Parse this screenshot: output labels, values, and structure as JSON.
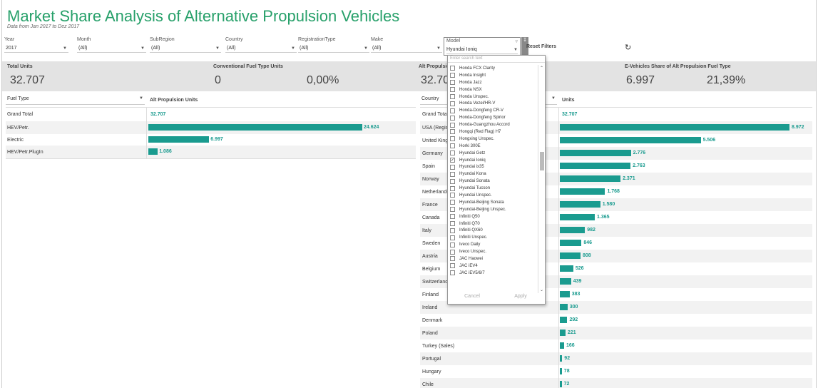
{
  "header": {
    "title": "Market Share Analysis of Alternative Propulsion Vehicles",
    "subtitle": "Data from Jan 2017 to Dez 2017"
  },
  "filters": [
    {
      "label": "Year",
      "value": "2017"
    },
    {
      "label": "Month",
      "value": "(All)"
    },
    {
      "label": "SubRegion",
      "value": "(All)"
    },
    {
      "label": "Country",
      "value": "(All)"
    },
    {
      "label": "RegistrationType",
      "value": "(All)"
    },
    {
      "label": "Make",
      "value": "(All)"
    }
  ],
  "model_filter": {
    "label": "Model",
    "value": "Hyundai Ioniq"
  },
  "reset_label": "Reset Filters",
  "kpis": {
    "total_units_label": "Total Units",
    "total_units_value": "32.707",
    "conv_label": "Conventional Fuel Type Units",
    "conv_value": "0",
    "conv_pct": "0,00%",
    "alt_label": "Alt Propulsio",
    "alt_value": "32.70",
    "ev_label": "E-Vehicles Share of Alt Propulsion Fuel Type",
    "ev_value": "6.997",
    "ev_pct": "21,39%"
  },
  "left_table": {
    "selector": "Fuel Type",
    "column_header": "Alt Propulsion Units",
    "grand_total_label": "Grand Total",
    "grand_total_value": "32.707",
    "rows": [
      {
        "label": "HEV/Petr.",
        "value": 24624,
        "display": "24.624"
      },
      {
        "label": "Electric",
        "value": 6997,
        "display": "6.997"
      },
      {
        "label": "HEV/Petr.PlugIn",
        "value": 1086,
        "display": "1.086"
      }
    ]
  },
  "right_table": {
    "selector": "Country",
    "column_header": "Units",
    "grand_total_label": "Grand Total",
    "grand_total_value": "32.707",
    "rows": [
      {
        "label": "USA (Regist",
        "value": 8972,
        "display": "8.972"
      },
      {
        "label": "United Kingd",
        "value": 5506,
        "display": "5.506"
      },
      {
        "label": "Germany",
        "value": 2776,
        "display": "2.776"
      },
      {
        "label": "Spain",
        "value": 2763,
        "display": "2.763"
      },
      {
        "label": "Norway",
        "value": 2371,
        "display": "2.371"
      },
      {
        "label": "Netherlands",
        "value": 1768,
        "display": "1.768"
      },
      {
        "label": "France",
        "value": 1580,
        "display": "1.580"
      },
      {
        "label": "Canada",
        "value": 1365,
        "display": "1.365"
      },
      {
        "label": "Italy",
        "value": 982,
        "display": "982"
      },
      {
        "label": "Sweden",
        "value": 846,
        "display": "846"
      },
      {
        "label": "Austria",
        "value": 808,
        "display": "808"
      },
      {
        "label": "Belgium",
        "value": 526,
        "display": "526"
      },
      {
        "label": "Switzerland",
        "value": 439,
        "display": "439"
      },
      {
        "label": "Finland",
        "value": 383,
        "display": "383"
      },
      {
        "label": "Ireland",
        "value": 300,
        "display": "300"
      },
      {
        "label": "Denmark",
        "value": 292,
        "display": "292"
      },
      {
        "label": "Poland",
        "value": 221,
        "display": "221"
      },
      {
        "label": "Turkey (Sales)",
        "value": 166,
        "display": "166"
      },
      {
        "label": "Portugal",
        "value": 92,
        "display": "92"
      },
      {
        "label": "Hungary",
        "value": 78,
        "display": "78"
      },
      {
        "label": "Chile",
        "value": 72,
        "display": "72"
      }
    ]
  },
  "dropdown": {
    "search_placeholder": "Enter search text",
    "items": [
      {
        "label": "Honda FCX Clarity",
        "checked": false
      },
      {
        "label": "Honda Insight",
        "checked": false
      },
      {
        "label": "Honda Jazz",
        "checked": false
      },
      {
        "label": "Honda NSX",
        "checked": false
      },
      {
        "label": "Honda Unspec.",
        "checked": false
      },
      {
        "label": "Honda Vezel/HR-V",
        "checked": false
      },
      {
        "label": "Honda-Dongfeng CR-V",
        "checked": false
      },
      {
        "label": "Honda-Dongfeng Spirior",
        "checked": false
      },
      {
        "label": "Honda-Guangzhou Accord",
        "checked": false
      },
      {
        "label": "Hongqi (Red Flag) H7",
        "checked": false
      },
      {
        "label": "Hongxing Unspec.",
        "checked": false
      },
      {
        "label": "Horki 300E",
        "checked": false
      },
      {
        "label": "Hyundai Getz",
        "checked": false
      },
      {
        "label": "Hyundai Ioniq",
        "checked": true
      },
      {
        "label": "Hyundai ix35",
        "checked": false
      },
      {
        "label": "Hyundai Kona",
        "checked": false
      },
      {
        "label": "Hyundai Sonata",
        "checked": false
      },
      {
        "label": "Hyundai Tucson",
        "checked": false
      },
      {
        "label": "Hyundai Unspec.",
        "checked": false
      },
      {
        "label": "Hyundai-Beijing Sonata",
        "checked": false
      },
      {
        "label": "Hyundai-Beijing Unspec.",
        "checked": false
      },
      {
        "label": "Infiniti Q50",
        "checked": false
      },
      {
        "label": "Infiniti Q70",
        "checked": false
      },
      {
        "label": "Infiniti QX60",
        "checked": false
      },
      {
        "label": "Infiniti Unspec.",
        "checked": false
      },
      {
        "label": "Iveco Daily",
        "checked": false
      },
      {
        "label": "Iveco Unspec.",
        "checked": false
      },
      {
        "label": "JAC Haowei",
        "checked": false
      },
      {
        "label": "JAC iEV4",
        "checked": false
      },
      {
        "label": "JAC iEV5/6/7",
        "checked": false
      }
    ],
    "cancel_label": "Cancel",
    "apply_label": "Apply"
  },
  "colors": {
    "title": "#27a06a",
    "bar": "#1a9b8f",
    "band": "#e3e3e3"
  }
}
